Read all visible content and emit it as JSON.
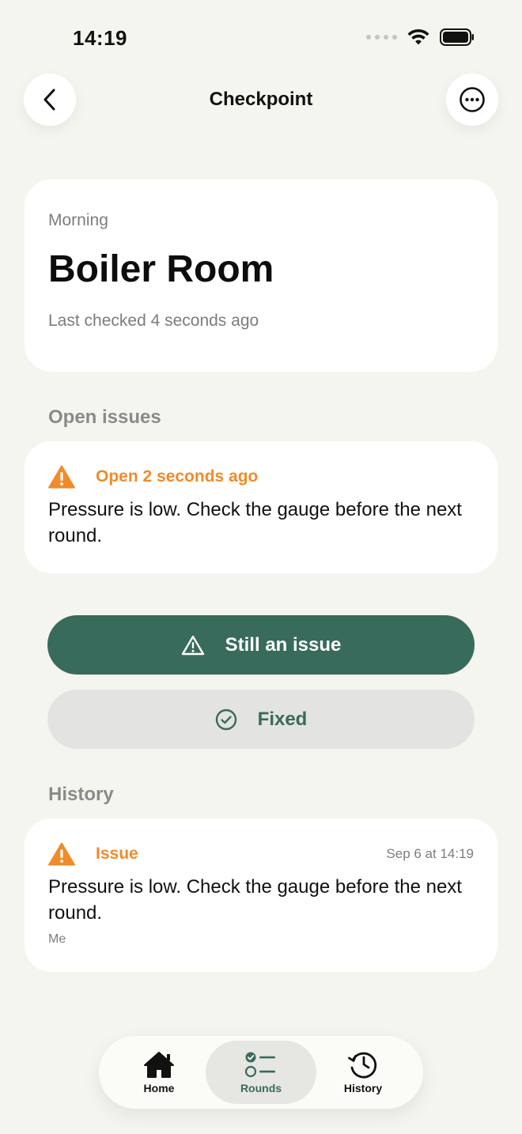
{
  "status_bar": {
    "time": "14:19"
  },
  "nav": {
    "title": "Checkpoint",
    "back_icon": "chevron-left-icon",
    "more_icon": "ellipsis-circle-icon"
  },
  "checkpoint": {
    "shift": "Morning",
    "name": "Boiler Room",
    "last_checked": "Last checked 4 seconds ago"
  },
  "open_issues": {
    "section_label": "Open issues",
    "items": [
      {
        "icon": "warning-triangle-icon",
        "status": "Open 2 seconds ago",
        "text": "Pressure is low. Check the gauge before the next round."
      }
    ]
  },
  "actions": {
    "still_issue_label": "Still an issue",
    "fixed_label": "Fixed"
  },
  "history": {
    "section_label": "History",
    "items": [
      {
        "icon": "warning-triangle-icon",
        "type": "Issue",
        "date": "Sep 6 at 14:19",
        "text": "Pressure is low. Check the gauge before the next round.",
        "author": "Me"
      }
    ]
  },
  "tabs": [
    {
      "label": "Home",
      "icon": "home-icon",
      "active": false
    },
    {
      "label": "Rounds",
      "icon": "checklist-icon",
      "active": true
    },
    {
      "label": "History",
      "icon": "clock-history-icon",
      "active": false
    }
  ],
  "colors": {
    "accent": "#386b5b",
    "warning": "#f08b2a",
    "background": "#f5f5f0"
  }
}
